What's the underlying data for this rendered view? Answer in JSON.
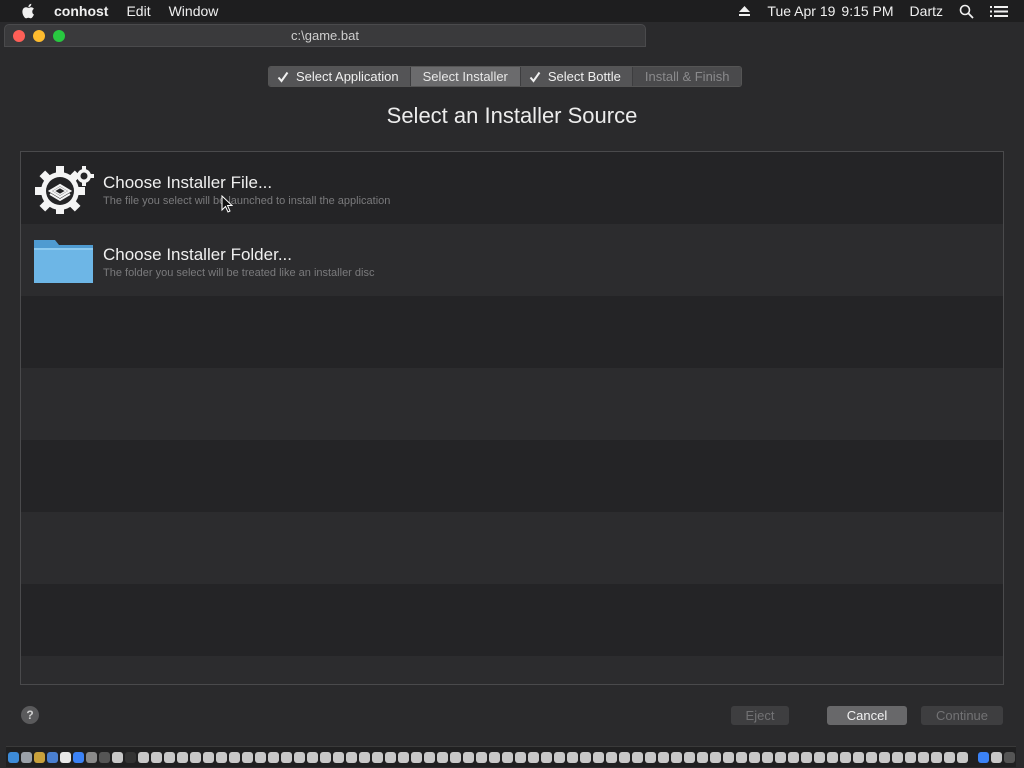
{
  "menubar": {
    "app_name": "conhost",
    "items": [
      "Edit",
      "Window"
    ],
    "date": "Tue Apr 19",
    "time": "9:15 PM",
    "user": "Dartz"
  },
  "window": {
    "title": "c:\\game.bat"
  },
  "steps": [
    {
      "label": "Select Application",
      "checked": true,
      "state": "done"
    },
    {
      "label": "Select Installer",
      "checked": false,
      "state": "current"
    },
    {
      "label": "Select Bottle",
      "checked": true,
      "state": "done"
    },
    {
      "label": "Install & Finish",
      "checked": false,
      "state": "disabled"
    }
  ],
  "heading": "Select an Installer Source",
  "options": [
    {
      "title": "Choose Installer File...",
      "subtitle": "The file you select will be launched to install the application",
      "icon": "installer-gear-icon"
    },
    {
      "title": "Choose Installer Folder...",
      "subtitle": "The folder you select will be treated like an installer disc",
      "icon": "folder-icon"
    }
  ],
  "buttons": {
    "help": "?",
    "eject": "Eject",
    "cancel": "Cancel",
    "continue": "Continue"
  },
  "colors": {
    "accent_folder": "#5aa9dc",
    "window_bg": "#2a2a2c"
  }
}
